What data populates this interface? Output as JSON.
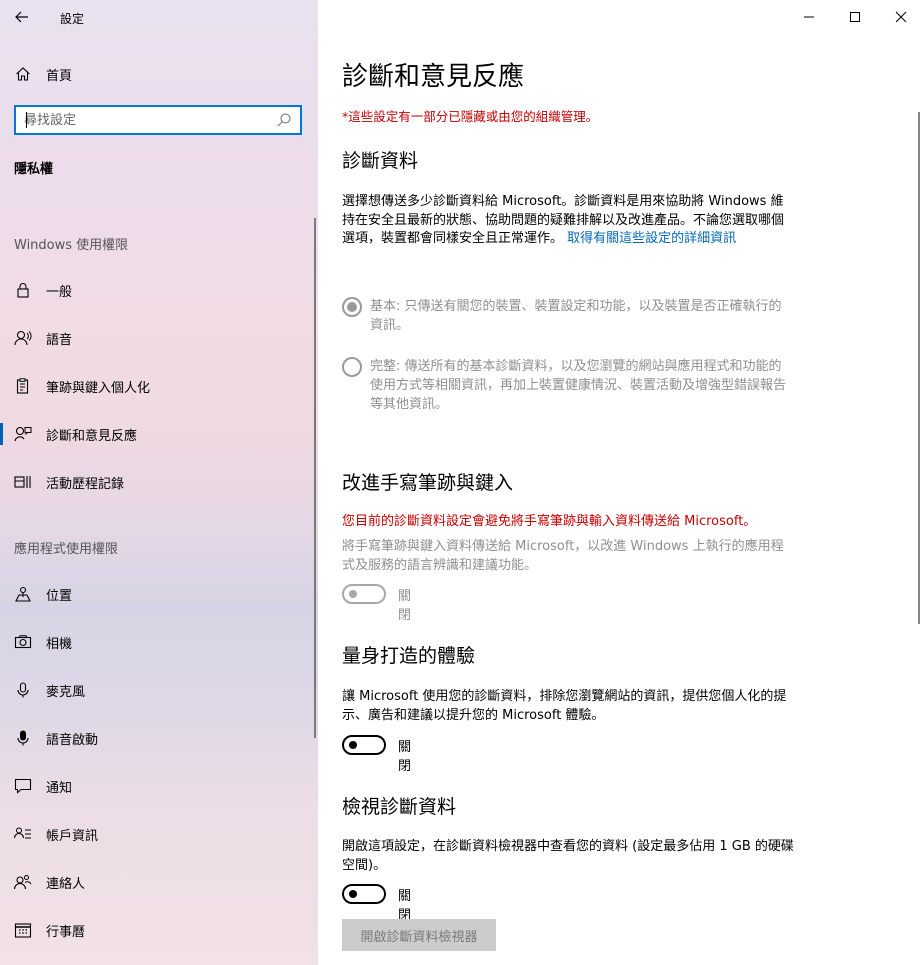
{
  "window": {
    "title": "設定",
    "minimize_icon": "minimize-icon",
    "maximize_icon": "maximize-icon",
    "close_icon": "close-icon"
  },
  "sidebar": {
    "home_label": "首頁",
    "search_placeholder": "尋找設定",
    "category": "隱私權",
    "windows_section": "Windows 使用權限",
    "windows_items": [
      {
        "label": "一般",
        "icon": "lock-icon"
      },
      {
        "label": "語音",
        "icon": "speech-icon"
      },
      {
        "label": "筆跡與鍵入個人化",
        "icon": "clipboard-pen-icon"
      },
      {
        "label": "診斷和意見反應",
        "icon": "feedback-icon",
        "selected": true
      },
      {
        "label": "活動歷程記錄",
        "icon": "timeline-icon"
      }
    ],
    "apps_section": "應用程式使用權限",
    "apps_items": [
      {
        "label": "位置",
        "icon": "location-icon"
      },
      {
        "label": "相機",
        "icon": "camera-icon"
      },
      {
        "label": "麥克風",
        "icon": "microphone-icon"
      },
      {
        "label": "語音啟動",
        "icon": "voice-activation-icon"
      },
      {
        "label": "通知",
        "icon": "notification-icon"
      },
      {
        "label": "帳戶資訊",
        "icon": "account-info-icon"
      },
      {
        "label": "連絡人",
        "icon": "contacts-icon"
      },
      {
        "label": "行事曆",
        "icon": "calendar-icon"
      }
    ]
  },
  "main": {
    "page_title": "診斷和意見反應",
    "managed_note": "*這些設定有一部分已隱藏或由您的組織管理。",
    "diagnostic_data": {
      "heading": "診斷資料",
      "description": "選擇想傳送多少診斷資料給 Microsoft。診斷資料是用來協助將 Windows 維持在安全且最新的狀態、協助問題的疑難排解以及改進產品。不論您選取哪個選項，裝置都會同樣安全且正常運作。",
      "link": "取得有關這些設定的詳細資訊",
      "basic_option": "基本: 只傳送有關您的裝置、裝置設定和功能，以及裝置是否正確執行的資訊。",
      "full_option": "完整: 傳送所有的基本診斷資料，以及您瀏覽的網站與應用程式和功能的使用方式等相關資訊，再加上裝置健康情況、裝置活動及增強型錯誤報告等其他資訊。",
      "basic_selected": true
    },
    "inking": {
      "heading": "改進手寫筆跡與鍵入",
      "warning": "您目前的診斷資料設定會避免將手寫筆跡與輸入資料傳送給 Microsoft。",
      "description": "將手寫筆跡與鍵入資料傳送給 Microsoft，以改進 Windows 上執行的應用程式及服務的語言辨識和建議功能。",
      "toggle_label": "關閉",
      "toggle_on": false
    },
    "tailored": {
      "heading": "量身打造的體驗",
      "description": "讓 Microsoft 使用您的診斷資料，排除您瀏覽網站的資訊，提供您個人化的提示、廣告和建議以提升您的 Microsoft 體驗。",
      "toggle_label": "關閉",
      "toggle_on": false
    },
    "view_diagnostic": {
      "heading": "檢視診斷資料",
      "description": "開啟這項設定，在診斷資料檢視器中查看您的資料 (設定最多佔用 1 GB 的硬碟空間)。",
      "toggle_label": "關閉",
      "toggle_on": false,
      "button_label": "開啟診斷資料檢視器"
    }
  }
}
